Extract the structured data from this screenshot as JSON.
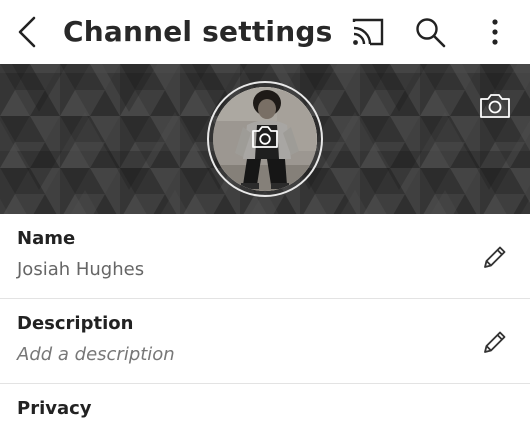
{
  "header": {
    "title": "Channel settings",
    "icons": [
      "back-arrow-icon",
      "cast-icon",
      "search-icon",
      "more-vert-icon"
    ]
  },
  "banner": {
    "icons": [
      "camera-icon"
    ]
  },
  "fields": {
    "name": {
      "label": "Name",
      "value": "Josiah Hughes"
    },
    "description": {
      "label": "Description",
      "placeholder": "Add a description"
    },
    "privacy": {
      "label": "Privacy"
    }
  },
  "colors": {
    "background": "#ffffff",
    "banner_dark": "#3a3a3a",
    "text_primary": "#222222",
    "text_secondary": "#666666",
    "divider": "#e3e3e3"
  }
}
